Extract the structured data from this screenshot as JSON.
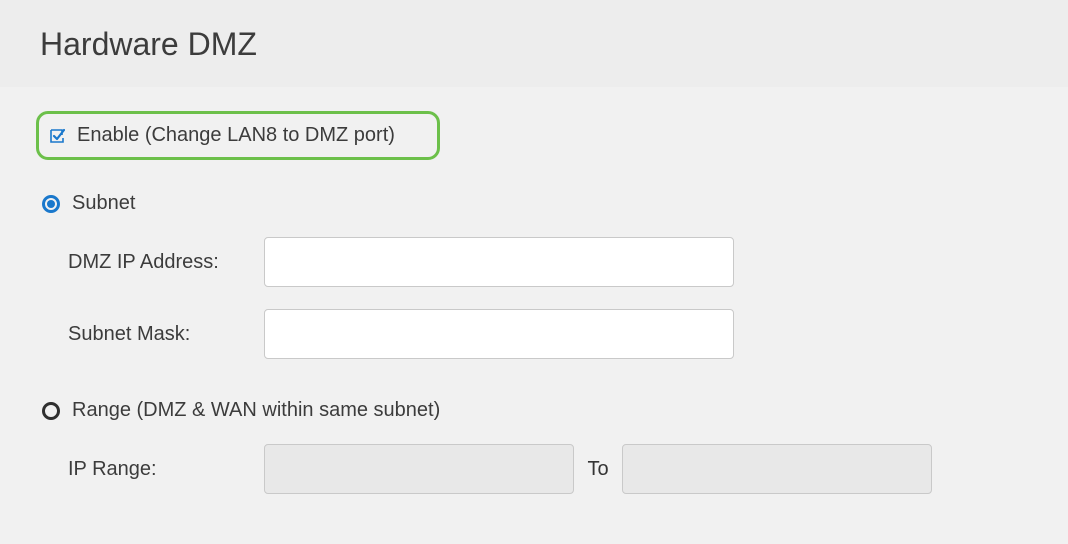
{
  "header": {
    "title": "Hardware DMZ"
  },
  "enable": {
    "label": "Enable (Change LAN8 to DMZ port)",
    "checked": true
  },
  "options": {
    "subnet": {
      "label": "Subnet",
      "selected": true,
      "fields": {
        "dmz_ip_label": "DMZ IP Address:",
        "dmz_ip_value": "",
        "subnet_mask_label": "Subnet Mask:",
        "subnet_mask_value": ""
      }
    },
    "range": {
      "label": "Range (DMZ & WAN within same subnet)",
      "selected": false,
      "fields": {
        "ip_range_label": "IP Range:",
        "ip_range_from_value": "",
        "to_label": "To",
        "ip_range_to_value": ""
      }
    }
  },
  "colors": {
    "accent": "#1a78cc",
    "highlight_border": "#6cc04a",
    "bg": "#f1f1f1"
  }
}
